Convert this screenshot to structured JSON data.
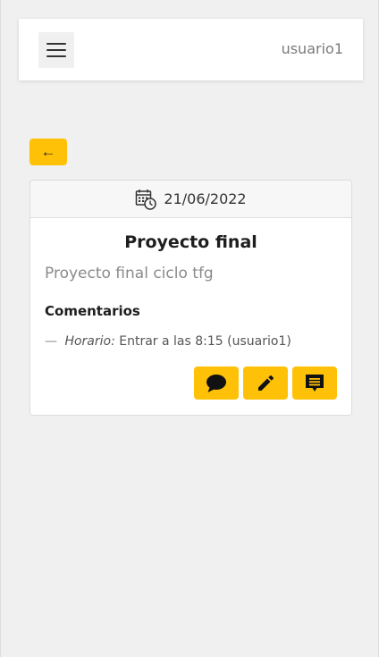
{
  "navbar": {
    "menu_icon": "hamburger-menu-icon",
    "username": "usuario1"
  },
  "back_button": {
    "icon": "arrow-left-icon",
    "glyph": "←"
  },
  "card": {
    "date_icon": "calendar-clock-icon",
    "date": "21/06/2022",
    "title": "Proyecto final",
    "subtitle": "Proyecto final ciclo tfg",
    "comments_heading": "Comentarios",
    "comments": [
      {
        "dash": "—",
        "label": "Horario:",
        "text": "Entrar a las 8:15 (usuario1)"
      }
    ],
    "actions": [
      {
        "icon": "comment-icon"
      },
      {
        "icon": "pencil-icon"
      },
      {
        "icon": "message-box-icon"
      }
    ]
  },
  "colors": {
    "accent": "#ffc107",
    "background": "#f0f0f0",
    "card_background": "#ffffff",
    "muted_text": "#8a8a8a"
  }
}
